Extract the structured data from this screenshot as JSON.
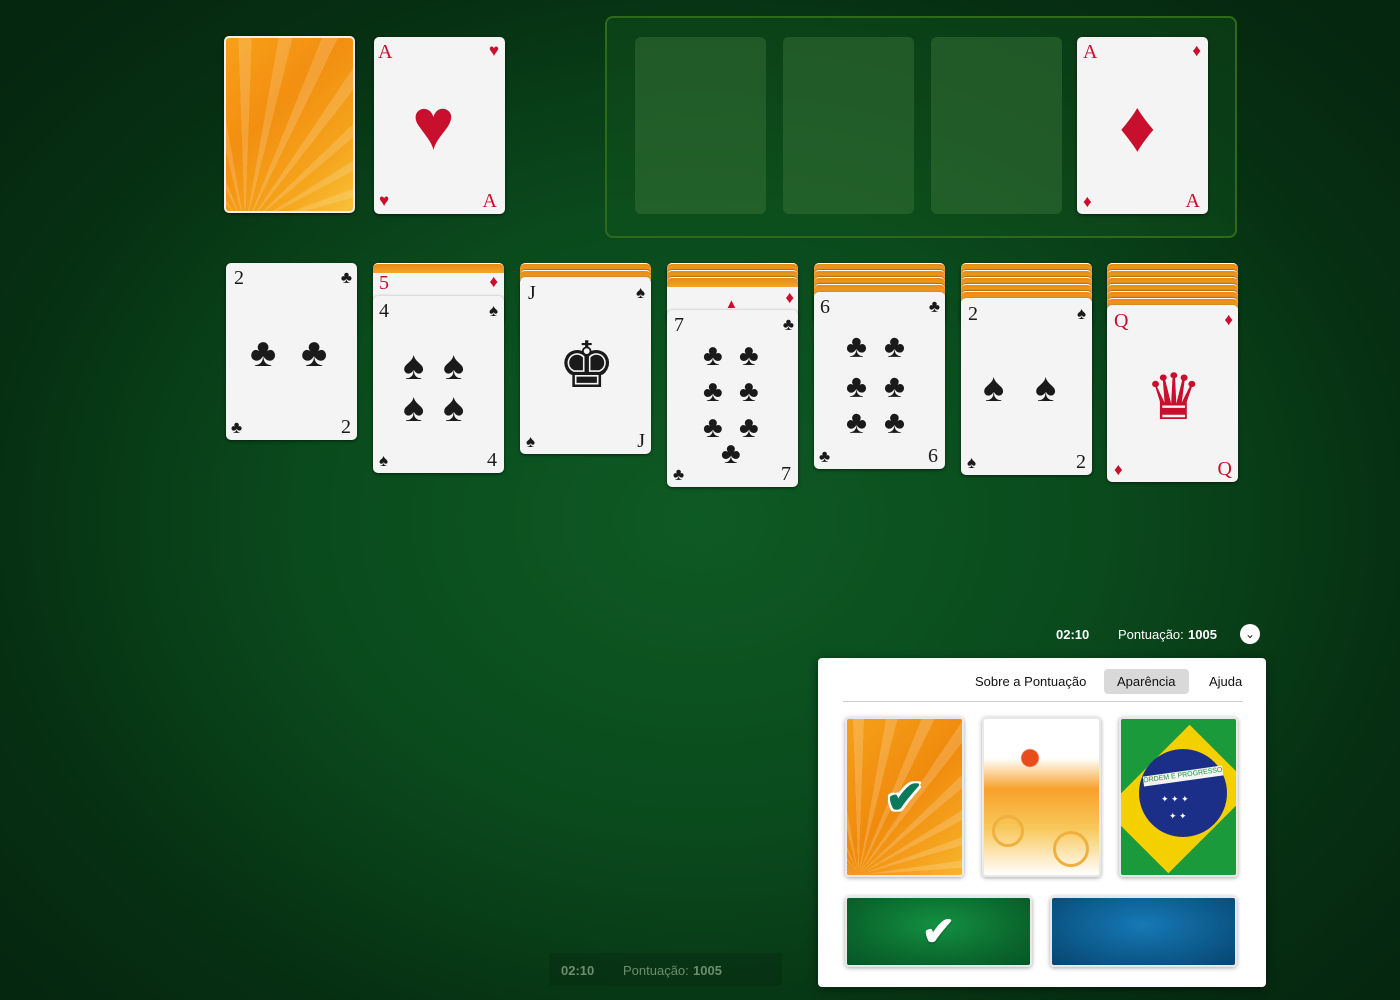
{
  "status": {
    "time": "02:10",
    "score_label": "Pontuação:",
    "score_value": "1005"
  },
  "bottom_status": {
    "time": "02:10",
    "score_label": "Pontuação:",
    "score_value": "1005"
  },
  "settings": {
    "tabs": [
      "Sobre a Pontuação",
      "Aparência",
      "Ajuda"
    ],
    "active_tab": "Aparência",
    "card_backs": [
      "orange-rays",
      "orange-splash",
      "brazil-flag"
    ],
    "selected_card_back": "orange-rays",
    "table_colors": [
      "#0e6b32",
      "#0a5a8c"
    ],
    "selected_table_color": "#0e6b32",
    "flag_banner_text": "ORDEM E PROGRESSO"
  },
  "waste": {
    "rank": "A",
    "suit": "♥"
  },
  "foundations": [
    {
      "empty": true
    },
    {
      "empty": true
    },
    {
      "empty": true
    },
    {
      "rank": "A",
      "suit": "♦"
    }
  ],
  "tableau": [
    {
      "hidden": [],
      "visible": [
        {
          "rank": "2",
          "suit": "♣"
        }
      ]
    },
    {
      "hidden": [
        {
          "rank": "5",
          "suit": "♦"
        }
      ],
      "visible": [
        {
          "rank": "4",
          "suit": "♠"
        }
      ]
    },
    {
      "hidden": [
        "back"
      ],
      "visible": [
        {
          "rank": "J",
          "suit": "♠"
        }
      ]
    },
    {
      "hidden": [
        "back",
        "back",
        "back"
      ],
      "visible": [
        {
          "rank": "7",
          "suit": "♣"
        }
      ]
    },
    {
      "hidden": [
        "back",
        "back",
        "back"
      ],
      "visible": [
        {
          "rank": "6",
          "suit": "♣"
        }
      ]
    },
    {
      "hidden": [
        "back",
        "back",
        "back",
        "back"
      ],
      "visible": [
        {
          "rank": "2",
          "suit": "♠"
        }
      ]
    },
    {
      "hidden": [
        "back",
        "back",
        "back",
        "back",
        "back"
      ],
      "visible": [
        {
          "rank": "Q",
          "suit": "♦"
        }
      ]
    }
  ],
  "colors": {
    "table": "#0a4a1c",
    "card_back": "#f28f10",
    "red_suit": "#c8102e"
  }
}
